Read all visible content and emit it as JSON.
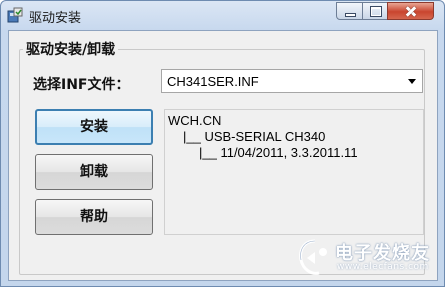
{
  "window": {
    "title": "驱动安装"
  },
  "group": {
    "label": "驱动安装/卸载",
    "inf_label": "选择INF文件：",
    "inf_select": {
      "selected": "CH341SER.INF"
    }
  },
  "buttons": {
    "install": "安装",
    "uninstall": "卸载",
    "help": "帮助"
  },
  "info": {
    "lines": [
      "WCH.CN",
      "|__ USB-SERIAL CH340",
      "|__ 11/04/2011, 3.3.2011.11"
    ]
  },
  "watermark": {
    "title": "电子发烧友",
    "url": "www.elecfans.com"
  }
}
